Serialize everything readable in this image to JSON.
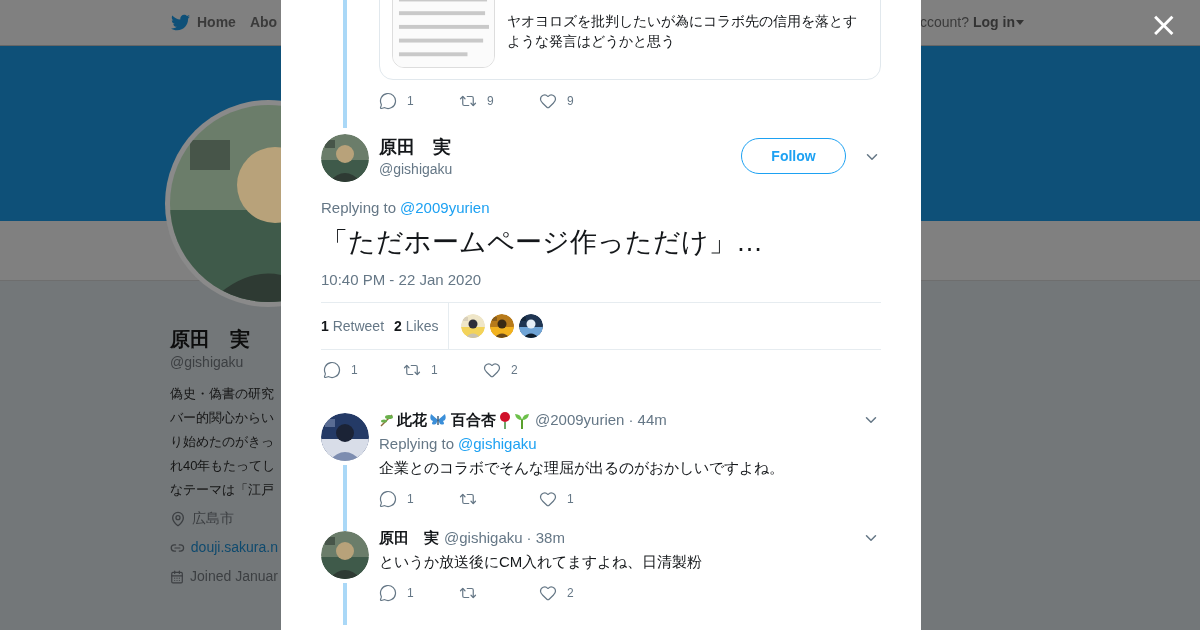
{
  "background_page": {
    "nav": {
      "items": [
        {
          "label": "Home",
          "kind": "home"
        },
        {
          "label": "Abo",
          "kind": "plain"
        }
      ],
      "account_prompt": "ccount?",
      "login": "Log in"
    },
    "profile": {
      "name": "原田　実",
      "handle": "@gishigaku",
      "bio_lines": [
        "偽史・偽書の研究",
        "バー的関心からい",
        "り始めたのがきっ",
        "れ40年もたってし",
        "なテーマは「江戸"
      ],
      "location": "広島市",
      "link": "douji.sakura.n",
      "joined": "Joined Januar"
    }
  },
  "modal": {
    "quoted_card": {
      "text_lines": [
        "ヤオヨロズを批判したいが為にコラボ先の信用を落とす",
        "ような発言はどうかと思う"
      ]
    },
    "parent_actions": {
      "replies": "1",
      "retweets": "9",
      "likes": "9"
    },
    "tweet": {
      "name": "原田　実",
      "handle": "@gishigaku",
      "follow_label": "Follow",
      "replying_prefix": "Replying to",
      "replying_to": "@2009yurien",
      "text": "「ただホームページ作っただけ」…",
      "time": "10:40 PM - 22 Jan 2020",
      "retweet_count": "1",
      "retweet_label": "Retweet",
      "like_count": "2",
      "like_label": "Likes",
      "likers": [
        {
          "kind": "blond"
        },
        {
          "kind": "orange"
        },
        {
          "kind": "blue"
        }
      ],
      "actions": {
        "replies": "1",
        "retweets": "1",
        "likes": "2"
      }
    },
    "replies": [
      {
        "kind": "emoji_name",
        "name_segments": [
          "此花",
          "百合杏"
        ],
        "handle": "@2009yurien",
        "age": "· 44m",
        "replying_prefix": "Replying to",
        "replying_to": "@gishigaku",
        "text": "企業とのコラボでそんな理屈が出るのがおかしいですよね。",
        "actions": {
          "replies": "1",
          "likes": "1"
        }
      },
      {
        "kind": "plain",
        "name_segments": [
          "原田　実"
        ],
        "handle": "@gishigaku",
        "age": "· 38m",
        "text": "というか放送後にCM入れてますよね、日清製粉",
        "actions": {
          "replies": "1",
          "likes": "2"
        }
      }
    ]
  },
  "close_label": "×"
}
